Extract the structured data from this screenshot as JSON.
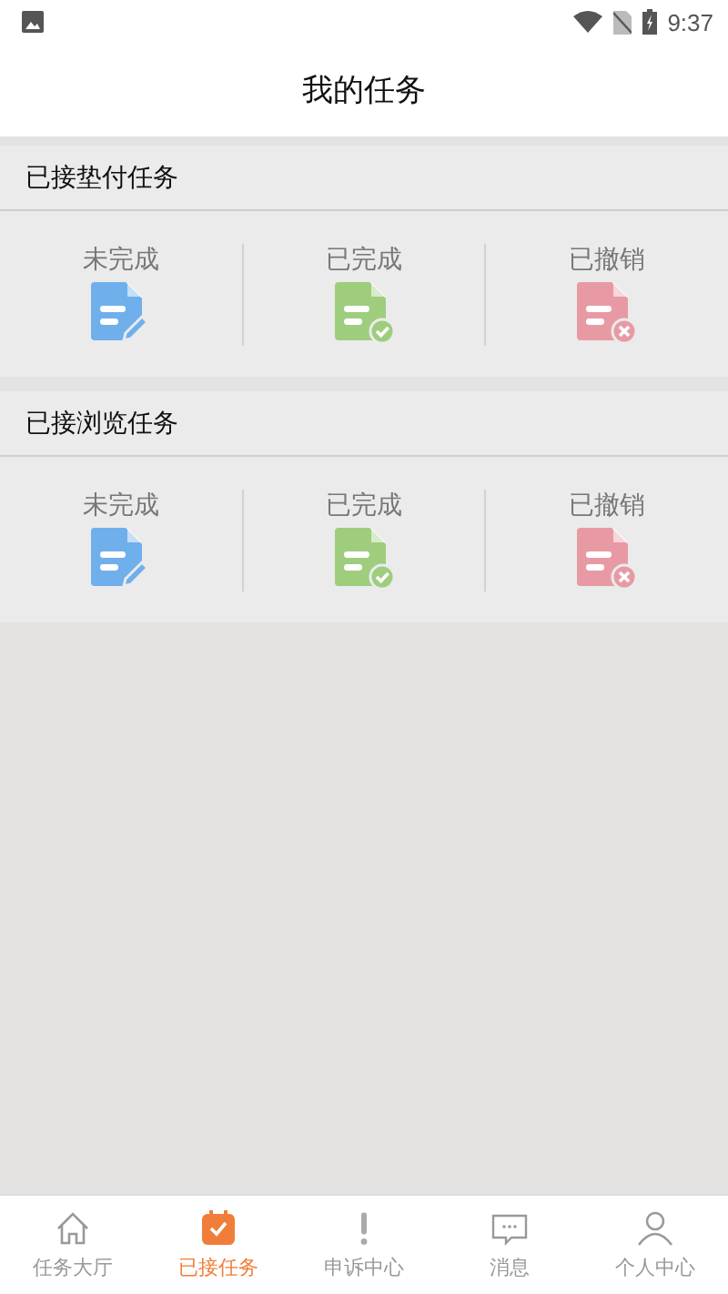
{
  "status_bar": {
    "time": "9:37"
  },
  "header": {
    "title": "我的任务"
  },
  "sections": [
    {
      "title": "已接垫付任务",
      "items": [
        {
          "label": "未完成",
          "kind": "pending"
        },
        {
          "label": "已完成",
          "kind": "done"
        },
        {
          "label": "已撤销",
          "kind": "cancelled"
        }
      ]
    },
    {
      "title": "已接浏览任务",
      "items": [
        {
          "label": "未完成",
          "kind": "pending"
        },
        {
          "label": "已完成",
          "kind": "done"
        },
        {
          "label": "已撤销",
          "kind": "cancelled"
        }
      ]
    }
  ],
  "tabs": [
    {
      "label": "任务大厅",
      "kind": "home",
      "selected": false
    },
    {
      "label": "已接任务",
      "kind": "task",
      "selected": true
    },
    {
      "label": "申诉中心",
      "kind": "complaint",
      "selected": false
    },
    {
      "label": "消息",
      "kind": "message",
      "selected": false
    },
    {
      "label": "个人中心",
      "kind": "person",
      "selected": false
    }
  ]
}
